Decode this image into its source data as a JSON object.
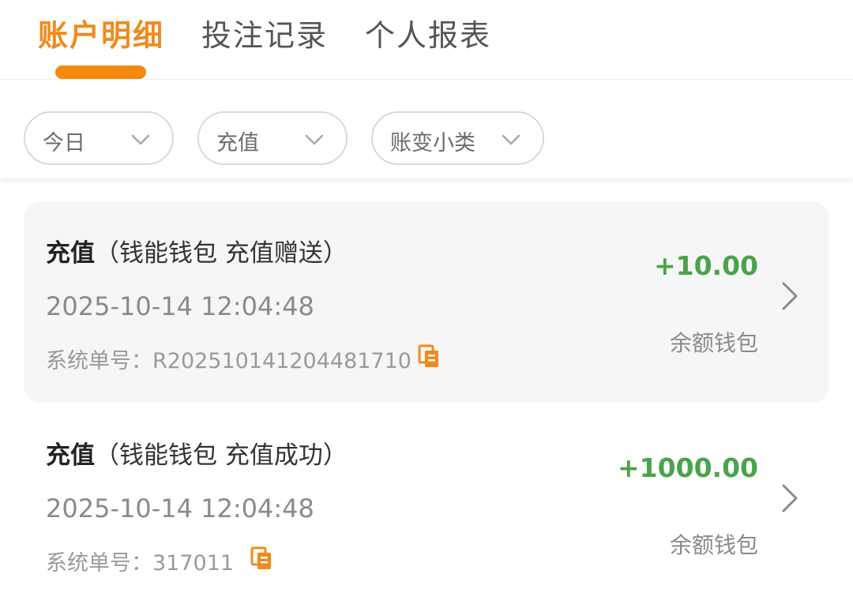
{
  "tabs": [
    {
      "label": "账户明细",
      "active": true
    },
    {
      "label": "投注记录",
      "active": false
    },
    {
      "label": "个人报表",
      "active": false
    }
  ],
  "filters": {
    "date": "今日",
    "type": "充值",
    "subtype": "账变小类"
  },
  "records": [
    {
      "category": "充值",
      "detail": "（钱能钱包 充值赠送）",
      "time": "2025-10-14 12:04:48",
      "order_label": "系统单号：",
      "order_no": "R202510141204481710",
      "amount": "+10.00",
      "wallet": "余额钱包"
    },
    {
      "category": "充值",
      "detail": "（钱能钱包 充值成功）",
      "time": "2025-10-14 12:04:48",
      "order_label": "系统单号：",
      "order_no": "317011",
      "amount": "+1000.00",
      "wallet": "余额钱包"
    }
  ],
  "colors": {
    "accent": "#f5890e",
    "positive_amount": "#4aa34a",
    "card_highlight": "#f6f6f6"
  },
  "icons": {
    "filter_dropdown": "chevron-down-icon",
    "copy": "copy-icon",
    "row_arrow": "chevron-right-icon"
  }
}
